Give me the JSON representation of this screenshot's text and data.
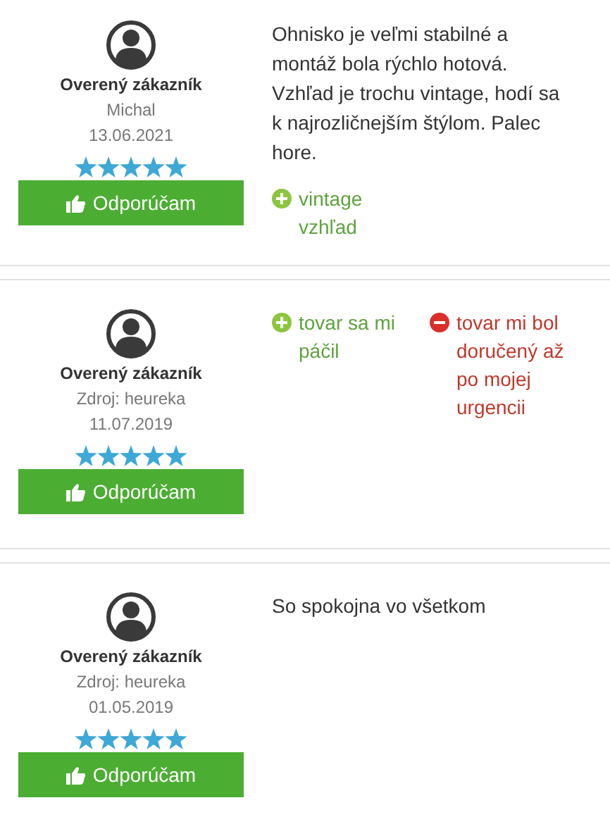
{
  "reviews": [
    {
      "author": "Overený zákazník",
      "subtitle": "Michal",
      "date": "13.06.2021",
      "stars": 5,
      "button": "Odporúčam",
      "text": "Ohnisko je veľmi stabilné a montáž bola rýchlo hotová. Vzhľad je trochu vintage, hodí sa k najrozličnejším štýlom. Palec hore.",
      "pros": [
        "vintage vzhľad"
      ]
    },
    {
      "author": "Overený zákazník",
      "subtitle": "Zdroj: heureka",
      "date": "11.07.2019",
      "stars": 5,
      "button": "Odporúčam",
      "pros": [
        "tovar sa mi páčil"
      ],
      "cons": [
        "tovar mi bol doručený až po mojej urgencii"
      ]
    },
    {
      "author": "Overený zákazník",
      "subtitle": "Zdroj: heureka",
      "date": "01.05.2019",
      "stars": 5,
      "button": "Odporúčam",
      "text": "So spokojna vo všetkom"
    }
  ]
}
